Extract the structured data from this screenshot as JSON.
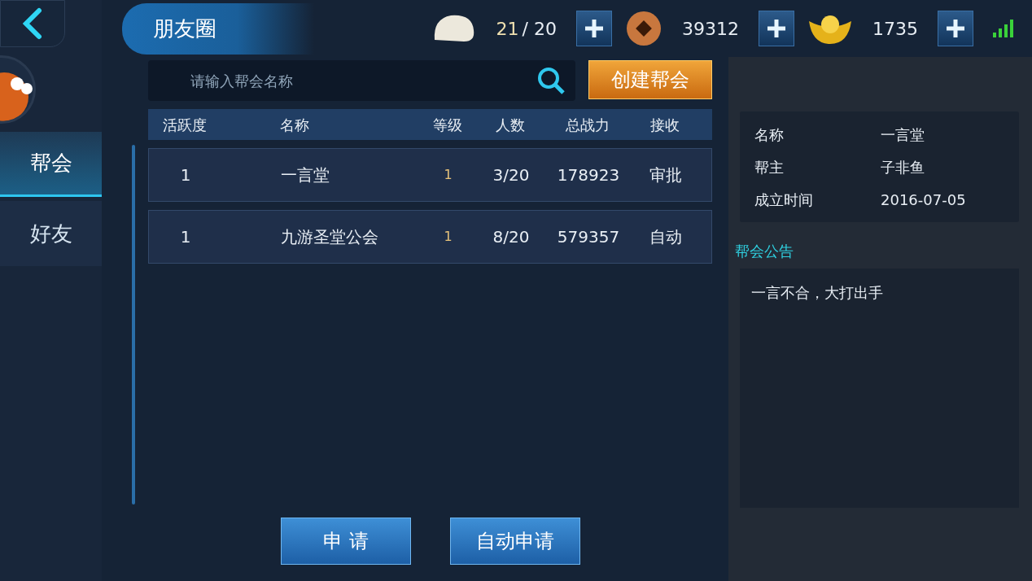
{
  "header": {
    "title": "朋友圈"
  },
  "resources": [
    {
      "kind": "stamina",
      "value": "21",
      "limit": "/ 20"
    },
    {
      "kind": "coin",
      "value": "39312"
    },
    {
      "kind": "gold",
      "value": "1735"
    }
  ],
  "sidebar": {
    "tabs": [
      {
        "label": "帮会",
        "selected": true
      },
      {
        "label": "好友",
        "selected": false
      }
    ]
  },
  "search": {
    "placeholder": "请输入帮会名称"
  },
  "create_button": "创建帮会",
  "table": {
    "columns": [
      "活跃度",
      "名称",
      "等级",
      "人数",
      "总战力",
      "接收"
    ],
    "rows": [
      [
        "1",
        "一言堂",
        "1",
        "3/20",
        "178923",
        "审批"
      ],
      [
        "1",
        "九游圣堂公会",
        "1",
        "8/20",
        "579357",
        "自动"
      ]
    ]
  },
  "buttons": [
    "申 请",
    "自动申请"
  ],
  "details": {
    "fields": [
      {
        "label": "名称",
        "value": "一言堂"
      },
      {
        "label": "帮主",
        "value": "子非鱼"
      },
      {
        "label": "成立时间",
        "value": "2016-07-05"
      }
    ],
    "notice_title": "帮会公告",
    "notice": "一言不合，大打出手"
  }
}
